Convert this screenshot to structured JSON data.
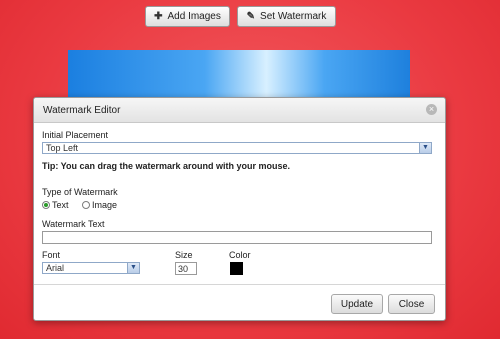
{
  "toolbar": {
    "add_images_icon": "plus-icon",
    "add_images_label": "Add Images",
    "set_watermark_icon": "brush-icon",
    "set_watermark_label": "Set Watermark"
  },
  "dialog": {
    "title": "Watermark Editor",
    "close_glyph": "⊗",
    "placement_label": "Initial Placement",
    "placement_value": "Top Left",
    "tip": "Tip: You can drag the watermark around with your mouse.",
    "type_label": "Type of Watermark",
    "type_options": [
      "Text",
      "Image"
    ],
    "type_selected": "Text",
    "text_label": "Watermark Text",
    "text_value": "",
    "font_label": "Font",
    "font_value": "Arial",
    "size_label": "Size",
    "size_value": "30",
    "color_label": "Color",
    "color_value": "#000000",
    "update_label": "Update",
    "close_label": "Close"
  },
  "colors": {
    "background": "#ea3a41",
    "preview_accent": "#4aa6f3"
  }
}
